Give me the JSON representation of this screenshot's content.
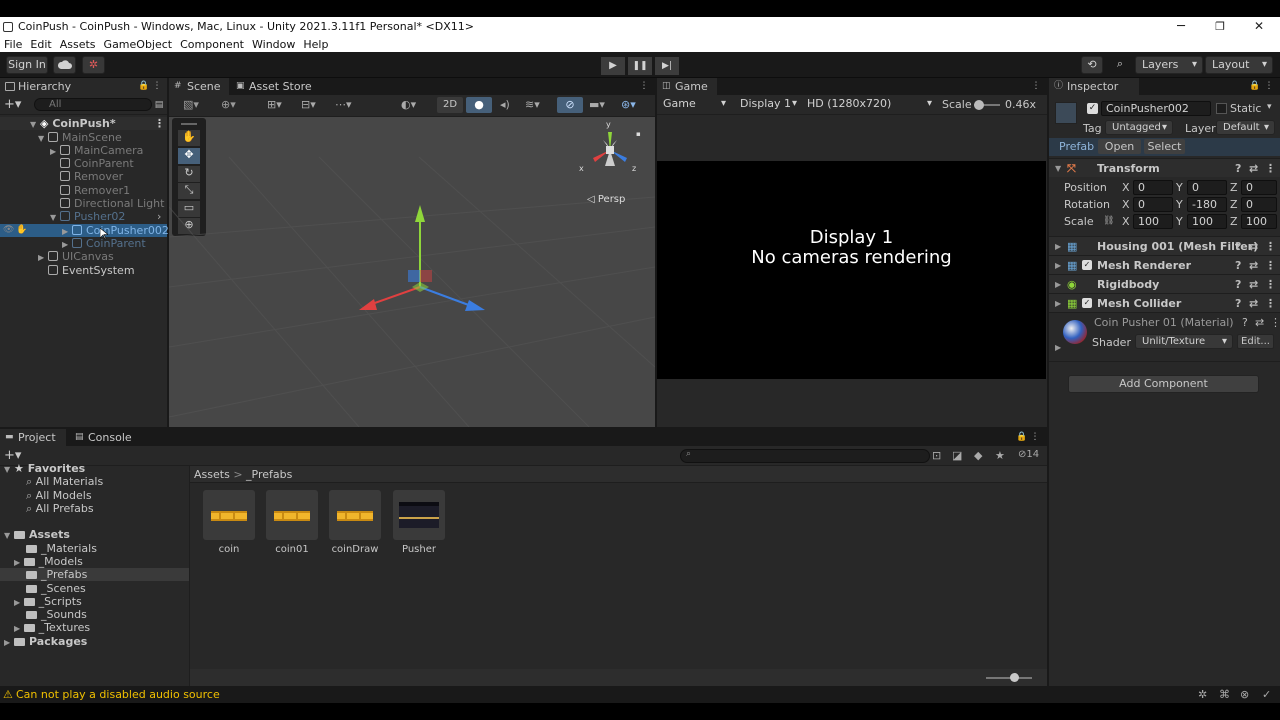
{
  "window": {
    "title": "CoinPush - CoinPush - Windows, Mac, Linux - Unity 2021.3.11f1 Personal* <DX11>",
    "controls": {
      "minimize": "─",
      "maximize": "❐",
      "close": "✕"
    }
  },
  "menu": [
    "File",
    "Edit",
    "Assets",
    "GameObject",
    "Component",
    "Window",
    "Help"
  ],
  "toolbar": {
    "sign_in": "Sign In",
    "layers_label": "Layers",
    "layout_label": "Layout",
    "play_glyphs": {
      "play": "▶",
      "pause": "❚❚",
      "step": "▶|"
    }
  },
  "hierarchy": {
    "tab_label": "Hierarchy",
    "search_placeholder": "All",
    "rows": [
      {
        "label": "CoinPush*",
        "kind": "scene"
      },
      {
        "label": "MainScene",
        "kind": "dim"
      },
      {
        "label": "MainCamera",
        "kind": "dim"
      },
      {
        "label": "CoinParent",
        "kind": "dim"
      },
      {
        "label": "Remover",
        "kind": "dim"
      },
      {
        "label": "Remover1",
        "kind": "dim"
      },
      {
        "label": "Directional Light",
        "kind": "dim"
      },
      {
        "label": "Pusher02",
        "kind": "prefabDim"
      },
      {
        "label": "CoinPusher002",
        "kind": "selected"
      },
      {
        "label": "CoinParent",
        "kind": "prefabDim"
      },
      {
        "label": "UICanvas",
        "kind": "dim"
      },
      {
        "label": "EventSystem",
        "kind": "normal"
      }
    ]
  },
  "scene": {
    "tab_label": "Scene",
    "asset_store_label": "Asset Store",
    "mode_2d": "2D",
    "persp_label": "◁ Persp",
    "gizmo_axes": {
      "y": "y",
      "x": "x",
      "z": "z"
    }
  },
  "game": {
    "tab_label": "Game",
    "mode": "Game",
    "display": "Display 1",
    "resolution": "HD (1280x720)",
    "scale_label": "Scale",
    "scale_value": "0.46x",
    "message_line1": "Display 1",
    "message_line2": "No cameras rendering"
  },
  "inspector": {
    "tab_label": "Inspector",
    "object_name": "CoinPusher002",
    "static_label": "Static",
    "tag_label": "Tag",
    "tag_value": "Untagged",
    "layer_label": "Layer",
    "layer_value": "Default",
    "prefab_label": "Prefab",
    "prefab_open": "Open",
    "prefab_select": "Select",
    "transform": {
      "title": "Transform",
      "position_label": "Position",
      "rotation_label": "Rotation",
      "scale_label": "Scale",
      "position": {
        "x": "0",
        "y": "0",
        "z": "0"
      },
      "rotation": {
        "x": "0",
        "y": "-180",
        "z": "0"
      },
      "scale": {
        "x": "100",
        "y": "100",
        "z": "100"
      },
      "axis": {
        "x": "X",
        "y": "Y",
        "z": "Z"
      }
    },
    "components": [
      "Housing 001 (Mesh Filter)",
      "Mesh Renderer",
      "Rigidbody",
      "Mesh Collider"
    ],
    "material_name": "Coin Pusher 01 (Material)",
    "shader_label": "Shader",
    "shader_value": "Unlit/Texture",
    "edit_label": "Edit...",
    "add_component": "Add Component"
  },
  "project": {
    "tab_label": "Project",
    "console_label": "Console",
    "hidden_count": "14",
    "favorites_label": "Favorites",
    "favorites": [
      "All Materials",
      "All Models",
      "All Prefabs"
    ],
    "assets_label": "Assets",
    "folders": [
      "_Materials",
      "_Models",
      "_Prefabs",
      "_Scenes",
      "_Scripts",
      "_Sounds",
      "_Textures"
    ],
    "packages_label": "Packages",
    "breadcrumb": [
      "Assets",
      "_Prefabs"
    ],
    "items": [
      {
        "name": "coin",
        "thumb": "coin"
      },
      {
        "name": "coin01",
        "thumb": "coin"
      },
      {
        "name": "coinDraw",
        "thumb": "coin"
      },
      {
        "name": "Pusher",
        "thumb": "pusher"
      }
    ]
  },
  "status": {
    "message": "Can not play a disabled audio source",
    "warning_glyph": "⚠"
  },
  "colors": {
    "accent": "#2c5d87",
    "warning": "#f0c000",
    "panel": "#282828",
    "background": "#191919"
  }
}
